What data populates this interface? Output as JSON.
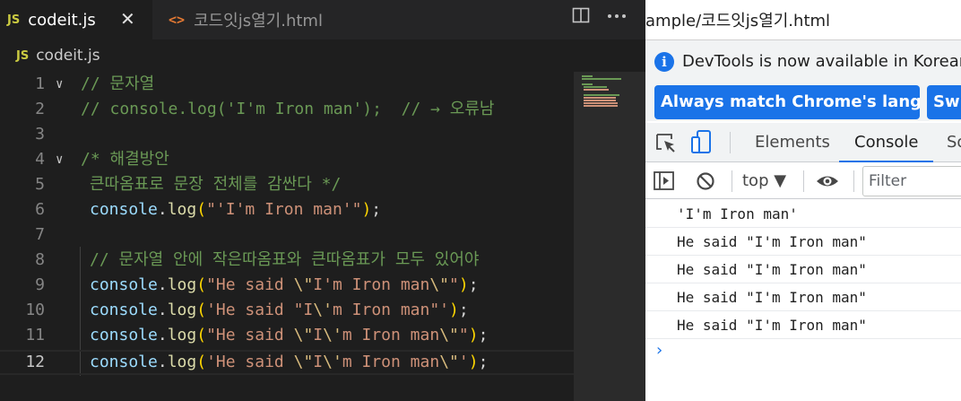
{
  "editor": {
    "tabs": [
      {
        "icon": "js-file-icon",
        "icon_text": "JS",
        "label": "codeit.js",
        "active": true
      },
      {
        "icon": "html-file-icon",
        "icon_text": "<>",
        "label": "코드잇js열기.html",
        "active": false
      }
    ],
    "tab_close_glyph": "✕",
    "breadcrumb": {
      "icon_text": "JS",
      "file": "codeit.js"
    },
    "toolbar_icons": [
      "split-editor-icon",
      "more-actions-icon"
    ],
    "lines": [
      {
        "n": "1"
      },
      {
        "n": "2"
      },
      {
        "n": "3"
      },
      {
        "n": "4"
      },
      {
        "n": "5"
      },
      {
        "n": "6"
      },
      {
        "n": "7"
      },
      {
        "n": "8"
      },
      {
        "n": "9"
      },
      {
        "n": "10"
      },
      {
        "n": "11"
      },
      {
        "n": "12"
      }
    ],
    "code": {
      "l1": "// 문자열",
      "l2": "// console.log('I'm Iron man');  // → 오류남",
      "l4": "/* 해결방안",
      "l5": "큰따옴표로 문장 전체를 감싼다 */",
      "l6_str": "\"'I'm Iron man'\"",
      "l8": "// 문자열 안에 작은따옴표와 큰따옴표가 모두 있어야",
      "l9_s1": "\"He said ",
      "l9_e1": "\\\"",
      "l9_s2": "I'm Iron man",
      "l9_e2": "\\\"",
      "l9_s3": "\"",
      "l10_s1": "'He said \"I",
      "l10_e1": "\\'",
      "l10_s2": "m Iron man\"'",
      "l11_s1": "\"He said ",
      "l11_e1": "\\\"",
      "l11_s2": "I",
      "l11_e2": "\\'",
      "l11_s3": "m Iron man",
      "l11_e3": "\\\"",
      "l11_s4": "\"",
      "l12_s1": "'He said ",
      "l12_e1": "\\\"",
      "l12_s2": "I",
      "l12_e2": "\\'",
      "l12_s3": "m Iron man",
      "l12_e3": "\\\"",
      "l12_s4": "'",
      "console": "console",
      "log": "log",
      "dot": ".",
      "open": "(",
      "close": ")",
      "semi": ";"
    },
    "current_line": "12",
    "colors": {
      "comment": "#6a9955",
      "function": "#dcdcaa",
      "object": "#9cdcfe",
      "string": "#ce9178",
      "escape": "#d7ba7d",
      "bracket": "#ffd700"
    }
  },
  "browser": {
    "address": "ample/코드잇js열기.html",
    "infobar": {
      "icon_text": "i",
      "message": "DevTools is now available in Korean!",
      "button_match": "Always match Chrome's language",
      "button_switch": "Swit"
    },
    "devtools_tabs": {
      "icons": [
        "inspect-element-icon",
        "device-toolbar-icon"
      ],
      "elements": "Elements",
      "console": "Console",
      "sources": "So"
    },
    "console_toolbar": {
      "context": "top ▼",
      "filter_placeholder": "Filter",
      "icons": [
        "sidebar-toggle-icon",
        "clear-console-icon",
        "eye-icon"
      ]
    },
    "console_output": [
      "'I'm Iron man'",
      "He said \"I'm Iron man\"",
      "He said \"I'm Iron man\"",
      "He said \"I'm Iron man\"",
      "He said \"I'm Iron man\""
    ],
    "prompt": "›",
    "accent": "#1a73e8"
  }
}
